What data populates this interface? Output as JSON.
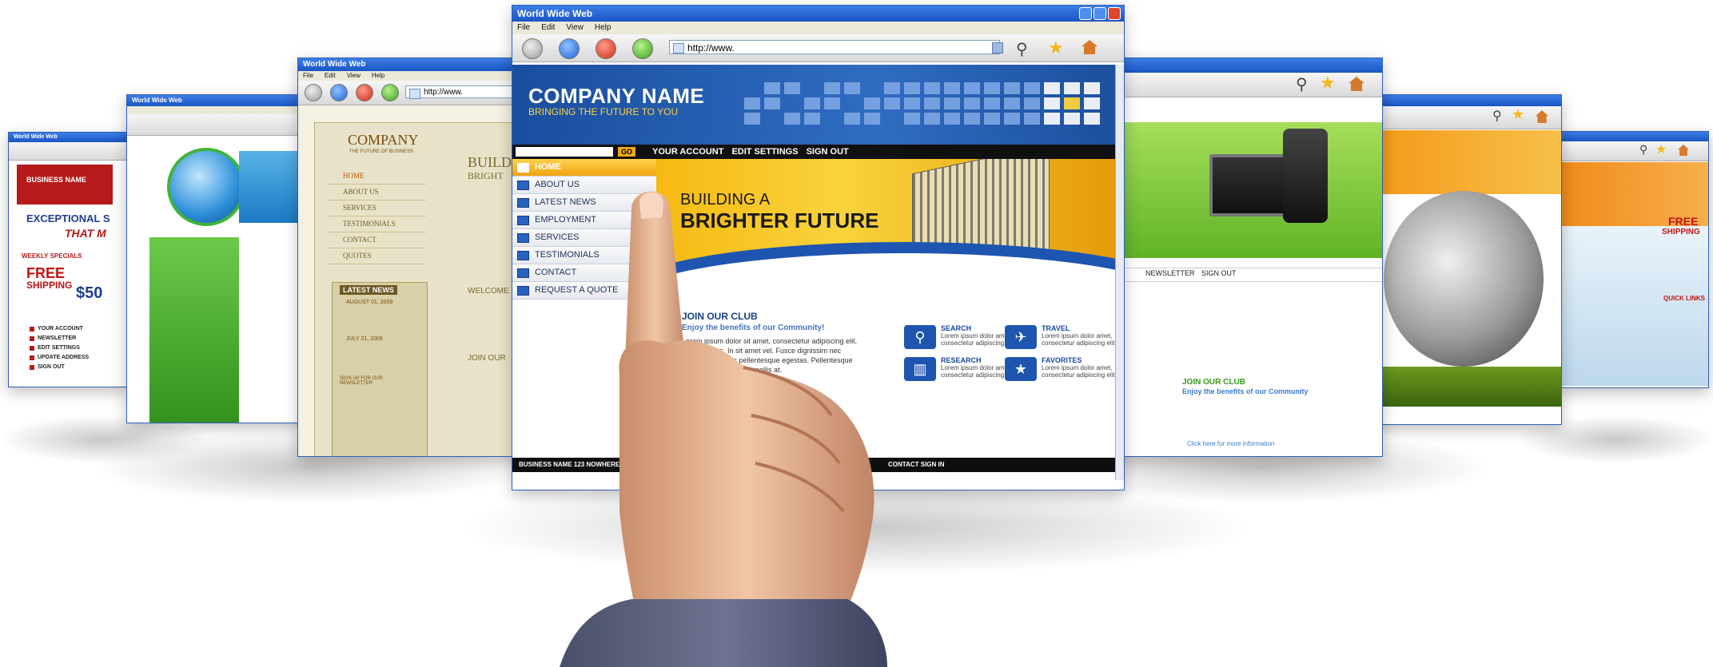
{
  "window": {
    "title": "World Wide Web",
    "menu": [
      "File",
      "Edit",
      "View",
      "Help"
    ],
    "address": "http://www."
  },
  "site": {
    "company": "COMPANY NAME",
    "tagline": "BRINGING THE FUTURE TO YOU",
    "search_go": "GO",
    "top_nav": [
      "YOUR ACCOUNT",
      "EDIT SETTINGS",
      "SIGN OUT"
    ],
    "side_nav": [
      "HOME",
      "ABOUT US",
      "LATEST NEWS",
      "EMPLOYMENT",
      "SERVICES",
      "TESTIMONIALS",
      "CONTACT",
      "REQUEST A QUOTE"
    ],
    "hero_line1": "BUILDING A",
    "hero_line2": "BRIGHTER FUTURE",
    "join_title": "JOIN OUR CLUB",
    "join_subtitle": "Enjoy the benefits of our Community!",
    "join_body": "Lorem ipsum dolor sit amet, consectetur adipiscing elit. Donec luctus. In sit amet vel. Fusce dignissim nec vestibulum lectus pellentesque egestas. Pellentesque lacus tellus, semper a mollis at.",
    "features": [
      {
        "title": "SEARCH",
        "text": "Lorem ipsum dolor amet, consectetur adipiscing elit."
      },
      {
        "title": "TRAVEL",
        "text": "Lorem ipsum dolor amet, consectetur adipiscing elit."
      },
      {
        "title": "RESEARCH",
        "text": "Lorem ipsum dolor amet, consectetur adipiscing elit."
      },
      {
        "title": "FAVORITES",
        "text": "Lorem ipsum dolor amet, consectetur adipiscing elit."
      }
    ],
    "footer": "BUSINESS NAME   123 NOWHERE STREET",
    "footer_right": "CONTACT    SIGN IN"
  },
  "left_window_3": {
    "company": "COMPANY",
    "tagline": "THE FUTURE OF BUSINESS",
    "nav": [
      "HOME",
      "ABOUT US",
      "SERVICES",
      "TESTIMONIALS",
      "CONTACT",
      "QUOTES"
    ],
    "heading": "BUILD",
    "heading2": "BRIGHT",
    "news_title": "LATEST NEWS",
    "news_dates": [
      "AUGUST 01, 2009",
      "JULY 21, 2009"
    ],
    "welcome": "WELCOME",
    "join": "JOIN OUR",
    "newsletter": "SIGN UP FOR OUR NEWSLETTER"
  },
  "left_window_1": {
    "business": "BUSINESS NAME",
    "headline": "EXCEPTIONAL S",
    "headline2": "THAT M",
    "specials": "WEEKLY SPECIALS",
    "free": "FREE",
    "shipping": "SHIPPING",
    "price": "$50",
    "links": [
      "YOUR ACCOUNT",
      "NEWSLETTER",
      "EDIT SETTINGS",
      "UPDATE ADDRESS",
      "SIGN OUT"
    ]
  },
  "right_window_1": {
    "nav": [
      "NEWSLETTER",
      "SIGN OUT"
    ],
    "join_title": "JOIN OUR CLUB",
    "join_subtitle": "Enjoy the benefits of our Community",
    "more": "Click here for more information"
  },
  "right_window_3": {
    "free": "FREE",
    "shipping": "SHIPPING",
    "quick": "QUICK LINKS"
  },
  "colors": {
    "brand_blue": "#1a4e9e",
    "accent_gold": "#f0a30f",
    "titlebar": "#1a55c4"
  }
}
